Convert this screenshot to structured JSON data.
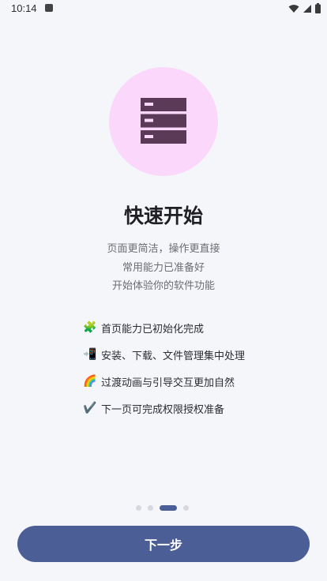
{
  "status_bar": {
    "time": "10:14"
  },
  "hero": {
    "icon": "server-icon",
    "circle_color": "#fbd7fb",
    "icon_color": "#5a3a57"
  },
  "onboarding": {
    "title": "快速开始",
    "subtitle_lines": [
      "页面更简洁，操作更直接",
      "常用能力已准备好",
      "开始体验你的软件功能"
    ],
    "features": [
      {
        "emoji": "🧩",
        "text": "首页能力已初始化完成"
      },
      {
        "emoji": "📲",
        "text": "安装、下载、文件管理集中处理"
      },
      {
        "emoji": "🌈",
        "text": "过渡动画与引导交互更加自然"
      },
      {
        "emoji": "✔️",
        "text": "下一页可完成权限授权准备"
      }
    ]
  },
  "pager": {
    "total": 4,
    "active_index": 2
  },
  "footer": {
    "next_label": "下一步",
    "accent": "#4b5f96"
  }
}
